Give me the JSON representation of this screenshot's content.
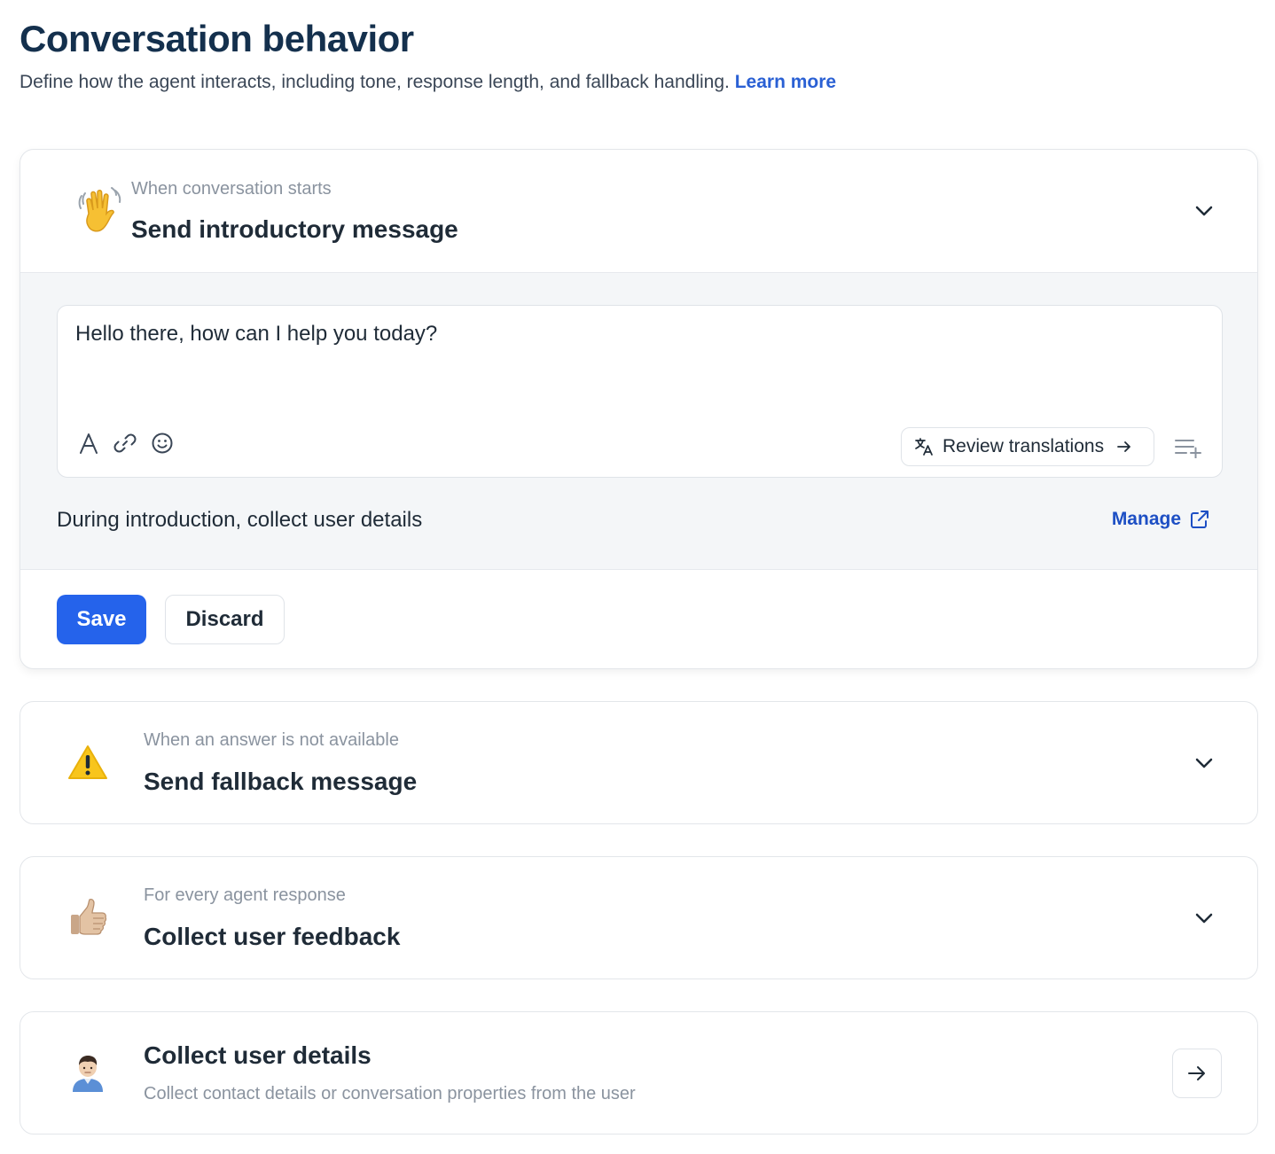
{
  "header": {
    "title": "Conversation behavior",
    "description": "Define how the agent interacts, including tone, response length, and fallback handling.",
    "learn_more": "Learn more"
  },
  "cards": [
    {
      "icon": "waving-hand-emoji",
      "kicker": "When conversation starts",
      "title": "Send introductory message",
      "expanded": true,
      "message": "Hello there, how can I help you today?",
      "review_translations": "Review translations",
      "collect_label": "During introduction, collect user details",
      "manage": "Manage",
      "save": "Save",
      "discard": "Discard"
    },
    {
      "icon": "warning-emoji",
      "kicker": "When an answer is not available",
      "title": "Send fallback message",
      "expanded": false
    },
    {
      "icon": "thumbs-up-emoji",
      "kicker": "For every agent response",
      "title": "Collect user feedback",
      "expanded": false
    },
    {
      "icon": "person-emoji",
      "title": "Collect user details",
      "description": "Collect contact details or conversation properties from the user"
    }
  ],
  "colors": {
    "title": "#14304d",
    "link": "#2a60d4",
    "primary": "#2563eb",
    "muted": "#8a939f",
    "panel_bg": "#f4f6f8",
    "border": "#e3e6ea"
  }
}
